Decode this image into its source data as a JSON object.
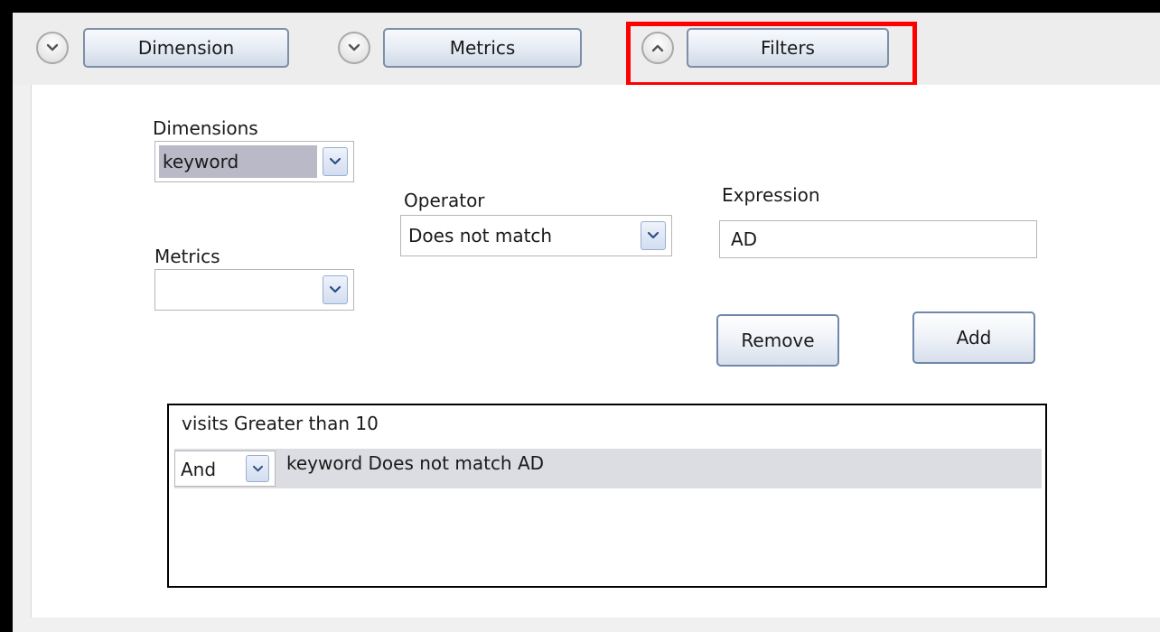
{
  "toolbar": {
    "tabs": [
      {
        "label": "Dimension",
        "toggle_icon": "chevron-down-icon"
      },
      {
        "label": "Metrics",
        "toggle_icon": "chevron-down-icon"
      },
      {
        "label": "Filters",
        "toggle_icon": "chevron-up-icon"
      }
    ]
  },
  "filters": {
    "dimensions": {
      "label": "Dimensions",
      "value": "keyword"
    },
    "metrics": {
      "label": "Metrics",
      "value": ""
    },
    "operator": {
      "label": "Operator",
      "value": "Does not match"
    },
    "expression": {
      "label": "Expression",
      "value": "AD"
    },
    "remove_label": "Remove",
    "add_label": "Add",
    "list": {
      "rows": [
        {
          "text": "visits Greater than 10"
        },
        {
          "conjunction": "And",
          "text": "keyword Does not match AD"
        }
      ]
    }
  },
  "colors": {
    "highlight": "#ff0000",
    "selected_row": "#dcdde3",
    "button_border": "#6f88ab"
  }
}
